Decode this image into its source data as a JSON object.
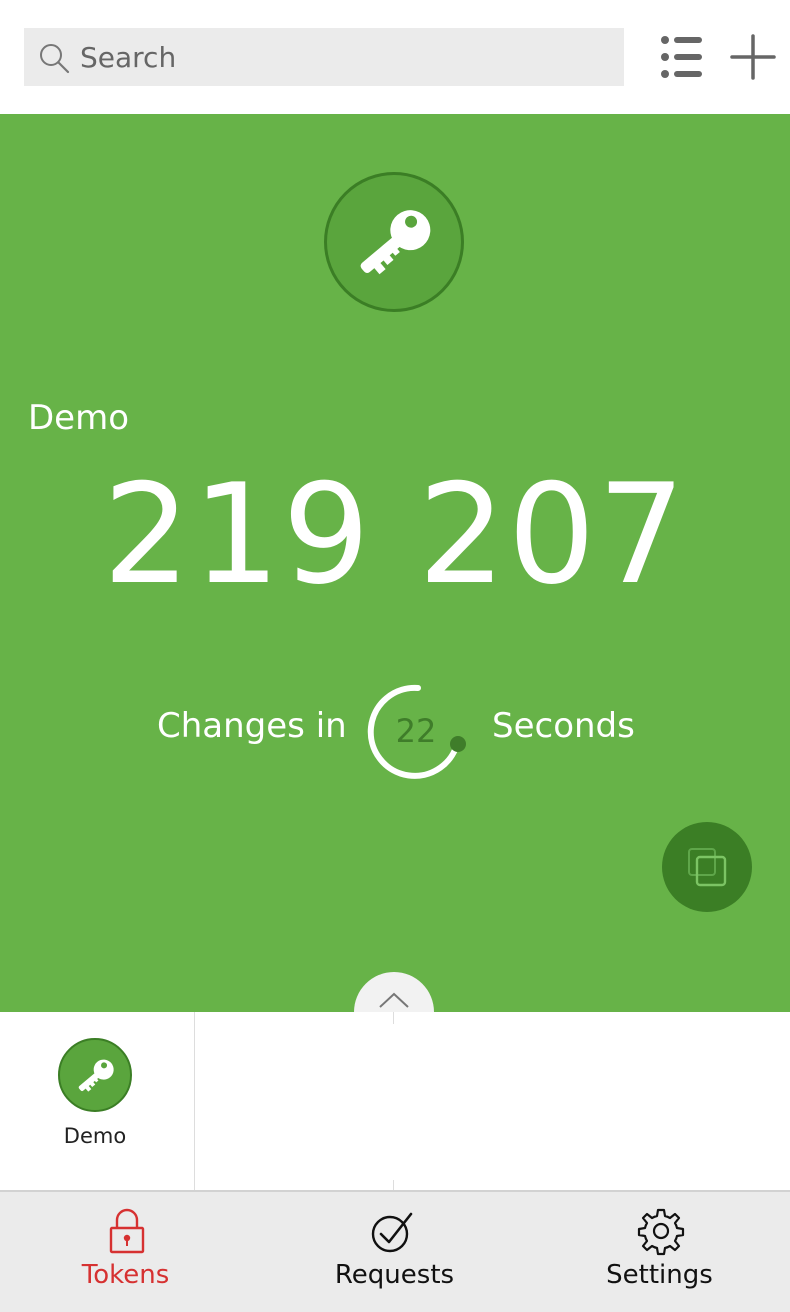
{
  "header": {
    "search": {
      "placeholder": "Search",
      "icon": "search-icon"
    },
    "list_icon": "list-icon",
    "add_icon": "plus-icon"
  },
  "token_panel": {
    "background": "#67b348",
    "icon": "key-icon",
    "name": "Demo",
    "code": "219 207",
    "changes_label": "Changes in",
    "seconds_remaining": "22",
    "seconds_label": "Seconds",
    "copy_icon": "copy-icon",
    "collapse_icon": "chevron-up-icon"
  },
  "token_list": {
    "items": [
      {
        "label": "Demo",
        "icon": "key-icon"
      }
    ]
  },
  "bottom_nav": {
    "items": [
      {
        "label": "Tokens",
        "icon": "lock-icon",
        "active": true,
        "color": "#d63131"
      },
      {
        "label": "Requests",
        "icon": "check-circle-icon",
        "active": false
      },
      {
        "label": "Settings",
        "icon": "gear-icon",
        "active": false
      }
    ]
  }
}
